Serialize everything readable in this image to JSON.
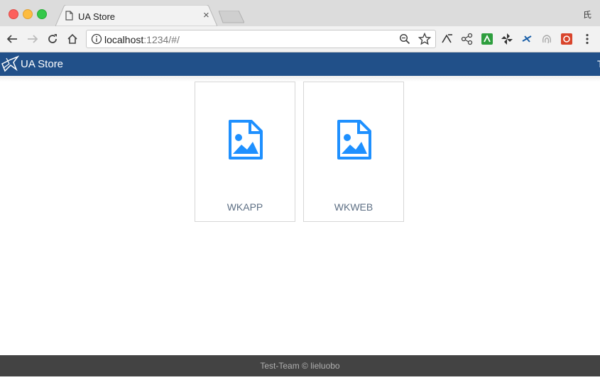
{
  "browser": {
    "tab_title": "UA Store",
    "tab_close": "×",
    "profile_label": "氏",
    "url_host": "localhost",
    "url_rest": ":1234/#/"
  },
  "app": {
    "title": "UA Store",
    "edge_text": "T",
    "accent_color": "#215089",
    "icon_color": "#1e90ff"
  },
  "cards": [
    {
      "label": "WKAPP",
      "icon": "image-file-icon"
    },
    {
      "label": "WKWEB",
      "icon": "image-file-icon"
    }
  ],
  "footer": {
    "text": "Test-Team © lieluobo"
  }
}
